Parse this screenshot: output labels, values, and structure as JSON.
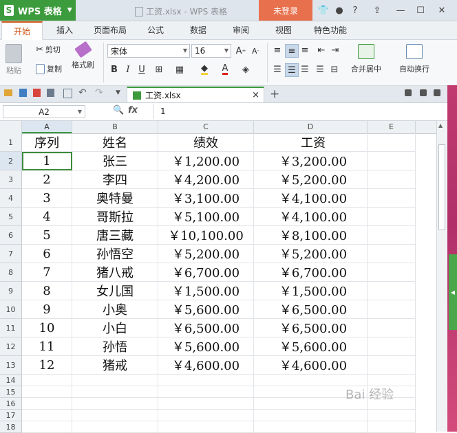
{
  "app": {
    "name": "WPS 表格",
    "logo": "S",
    "doc_title": "工资.xlsx - WPS 表格",
    "login_label": "未登录"
  },
  "tabs": [
    "开始",
    "插入",
    "页面布局",
    "公式",
    "数据",
    "审阅",
    "视图",
    "特色功能"
  ],
  "ribbon": {
    "paste": "粘贴",
    "cut": "剪切",
    "copy": "复制",
    "format_painter": "格式刷",
    "font_name": "宋体",
    "font_size": "16",
    "bold": "B",
    "italic": "I",
    "underline": "U",
    "merge_center": "合并居中",
    "wrap_text": "自动换行"
  },
  "doc_tab": {
    "filename": "工资.xlsx",
    "close": "×",
    "add": "+"
  },
  "formula_bar": {
    "name_box": "A2",
    "fx": "fx",
    "value": "1"
  },
  "columns": [
    "A",
    "B",
    "C",
    "D",
    "E"
  ],
  "row_numbers": [
    "1",
    "2",
    "3",
    "4",
    "5",
    "6",
    "7",
    "8",
    "9",
    "10",
    "11",
    "12",
    "13",
    "14",
    "15",
    "16",
    "17",
    "18"
  ],
  "sheet": {
    "header": [
      "序列",
      "姓名",
      "绩效",
      "工资"
    ],
    "rows": [
      [
        "1",
        "张三",
        "￥1,200.00",
        "￥3,200.00"
      ],
      [
        "2",
        "李四",
        "￥4,200.00",
        "￥5,200.00"
      ],
      [
        "3",
        "奥特曼",
        "￥3,100.00",
        "￥4,100.00"
      ],
      [
        "4",
        "哥斯拉",
        "￥5,100.00",
        "￥4,100.00"
      ],
      [
        "5",
        "唐三藏",
        "￥10,100.00",
        "￥8,100.00"
      ],
      [
        "6",
        "孙悟空",
        "￥5,200.00",
        "￥5,200.00"
      ],
      [
        "7",
        "猪八戒",
        "￥6,700.00",
        "￥6,700.00"
      ],
      [
        "8",
        "女儿国",
        "￥1,500.00",
        "￥1,500.00"
      ],
      [
        "9",
        "小奥",
        "￥5,600.00",
        "￥6,500.00"
      ],
      [
        "10",
        "小白",
        "￥6,500.00",
        "￥6,500.00"
      ],
      [
        "11",
        "孙悟",
        "￥5,600.00",
        "￥5,600.00"
      ],
      [
        "12",
        "猪戒",
        "￥4,600.00",
        "￥4,600.00"
      ]
    ]
  },
  "watermark": "Bai 经验",
  "colors": {
    "brand_green": "#3c9b3c",
    "login_orange": "#e8704d",
    "active_tab": "#d0581c"
  }
}
